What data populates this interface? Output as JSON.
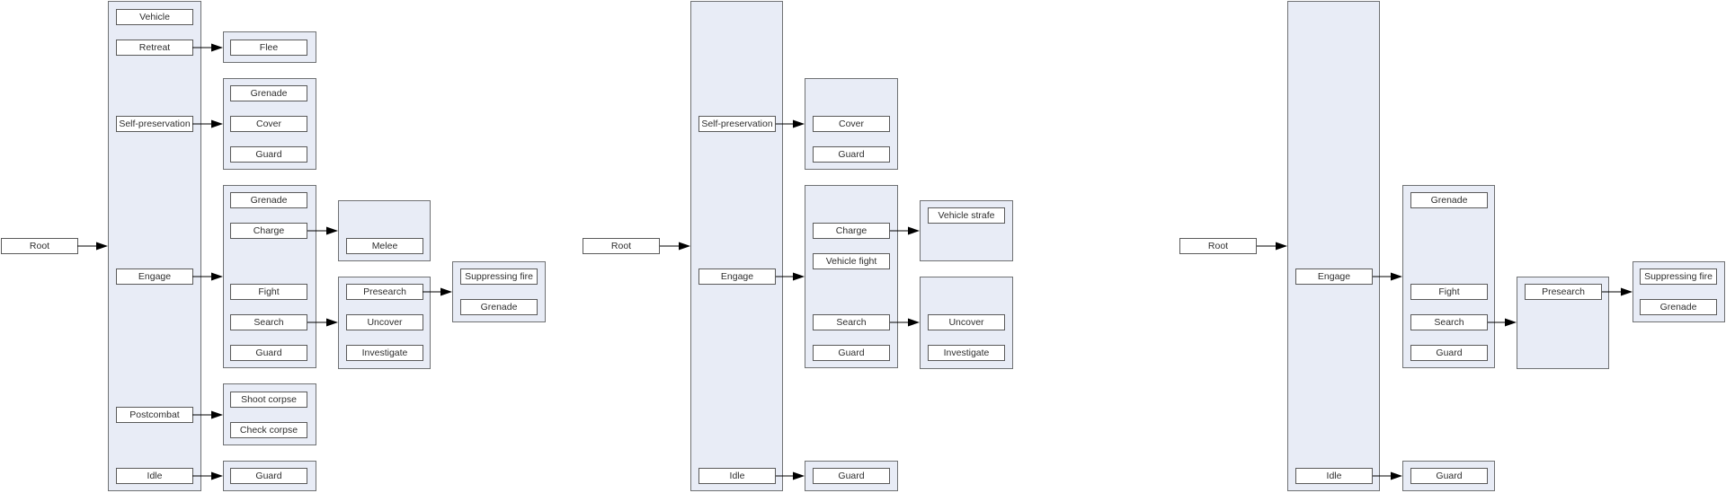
{
  "diagrams": [
    {
      "id": "full-tree",
      "root": "Root",
      "level1": [
        "Vehicle",
        "Retreat",
        "Self-preservation",
        "Engage",
        "Postcombat",
        "Idle"
      ],
      "groups": [
        {
          "parent": "Retreat",
          "children": [
            "Flee"
          ]
        },
        {
          "parent": "Self-preservation",
          "children": [
            "Grenade",
            "Cover",
            "Guard"
          ]
        },
        {
          "parent": "Engage",
          "children": [
            "Grenade",
            "Charge",
            "Fight",
            "Search",
            "Guard"
          ]
        },
        {
          "parent": "Charge",
          "children": [
            "Melee"
          ]
        },
        {
          "parent": "Search",
          "children": [
            "Presearch",
            "Uncover",
            "Investigate"
          ]
        },
        {
          "parent": "Presearch",
          "children": [
            "Suppressing fire",
            "Grenade"
          ]
        },
        {
          "parent": "Postcombat",
          "children": [
            "Shoot corpse",
            "Check corpse"
          ]
        },
        {
          "parent": "Idle",
          "children": [
            "Guard"
          ]
        }
      ]
    },
    {
      "id": "vehicle-tree",
      "root": "Root",
      "level1": [
        "Self-preservation",
        "Engage",
        "Idle"
      ],
      "groups": [
        {
          "parent": "Self-preservation",
          "children": [
            "Cover",
            "Guard"
          ]
        },
        {
          "parent": "Engage",
          "children": [
            "Charge",
            "Vehicle fight",
            "Search",
            "Guard"
          ]
        },
        {
          "parent": "Charge",
          "children": [
            "Vehicle strafe"
          ]
        },
        {
          "parent": "Search",
          "children": [
            "Uncover",
            "Investigate"
          ]
        },
        {
          "parent": "Idle",
          "children": [
            "Guard"
          ]
        }
      ]
    },
    {
      "id": "reduced-tree",
      "root": "Root",
      "level1": [
        "Engage",
        "Idle"
      ],
      "groups": [
        {
          "parent": "Engage",
          "children": [
            "Grenade",
            "Fight",
            "Search",
            "Guard"
          ]
        },
        {
          "parent": "Search",
          "children": [
            "Presearch"
          ]
        },
        {
          "parent": "Presearch",
          "children": [
            "Suppressing fire",
            "Grenade"
          ]
        },
        {
          "parent": "Idle",
          "children": [
            "Guard"
          ]
        }
      ]
    }
  ],
  "colors": {
    "container_fill": "#e8ecf6",
    "container_border": "#6f7173",
    "node_fill": "#ffffff",
    "node_border": "#5a5a5a",
    "edge": "#000000"
  }
}
